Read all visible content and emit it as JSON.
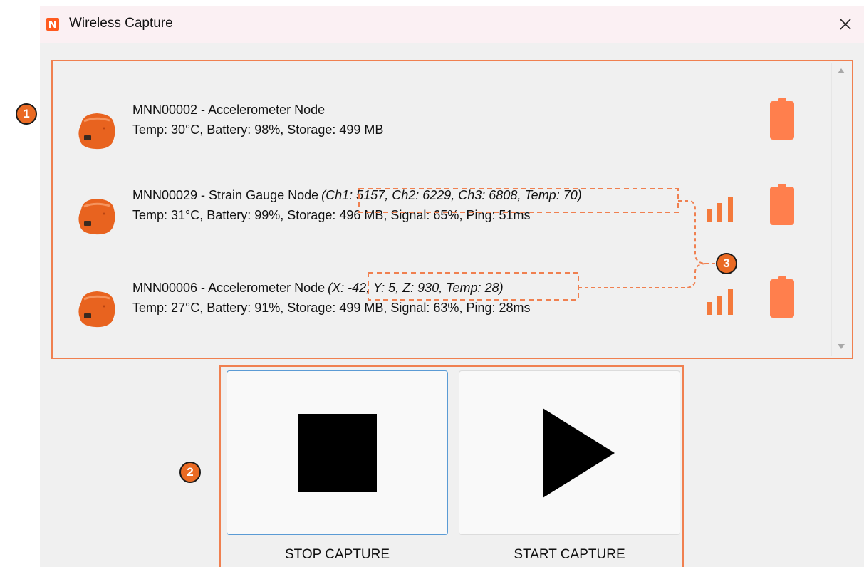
{
  "window": {
    "title": "Wireless Capture",
    "close_glyph": "✕",
    "logo_icon": "app-logo-icon"
  },
  "nodes": [
    {
      "title": "MNN00002 - Accelerometer Node",
      "live": "",
      "status": "Temp: 30°C, Battery: 98%, Storage: 499 MB",
      "show_signal": false,
      "battery_icon": "battery-icon"
    },
    {
      "title": "MNN00029 - Strain Gauge Node",
      "live": "(Ch1: 5157, Ch2: 6229, Ch3: 6808, Temp: 70)",
      "status": "Temp: 31°C, Battery: 99%, Storage: 496 MB, Signal: 65%, Ping: 51ms",
      "show_signal": true,
      "battery_icon": "battery-icon"
    },
    {
      "title": "MNN00006 - Accelerometer Node",
      "live": "(X: -42, Y: 5, Z: 930, Temp: 28)",
      "status": "Temp: 27°C, Battery: 91%, Storage: 499 MB, Signal: 63%, Ping: 28ms",
      "show_signal": true,
      "battery_icon": "battery-icon"
    }
  ],
  "buttons": {
    "stop_label": "STOP CAPTURE",
    "start_label": "START CAPTURE",
    "stop_icon": "stop-icon",
    "start_icon": "play-icon"
  },
  "callouts": [
    "1",
    "2",
    "3"
  ],
  "colors": {
    "accent": "#ea6a23",
    "annotation_outline": "#f08050",
    "node_body": "#e8631f",
    "battery": "#ff7f4d",
    "titlebar": "#fbf0f3",
    "dialog_bg": "#f0f0f0",
    "focus_border": "#5b9bd5"
  }
}
